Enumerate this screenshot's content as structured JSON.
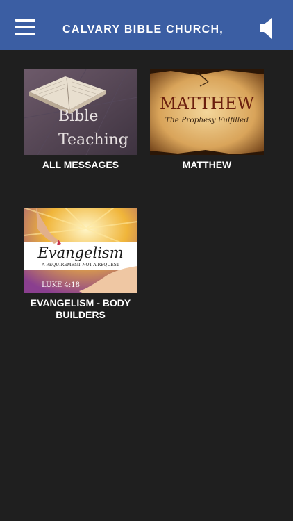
{
  "header": {
    "title": "CALVARY BIBLE CHURCH,",
    "menu_icon": "hamburger-menu-icon",
    "audio_icon": "speaker-icon"
  },
  "tiles": [
    {
      "label": "ALL MESSAGES",
      "thumb_text_1": "Bible",
      "thumb_text_2": "Teaching"
    },
    {
      "label": "MATTHEW",
      "thumb_text_1": "MATTHEW",
      "thumb_text_2": "The Prophesy Fulfilled"
    },
    {
      "label": "EVANGELISM - BODY BUILDERS",
      "thumb_text_1": "Evangelism",
      "thumb_text_2": "A REQUIREMENT   NOT A  REQUEST",
      "thumb_text_3": "LUKE 4:18"
    }
  ],
  "colors": {
    "header": "#3b5ea3",
    "background": "#1f1f1f",
    "text": "#ffffff"
  }
}
